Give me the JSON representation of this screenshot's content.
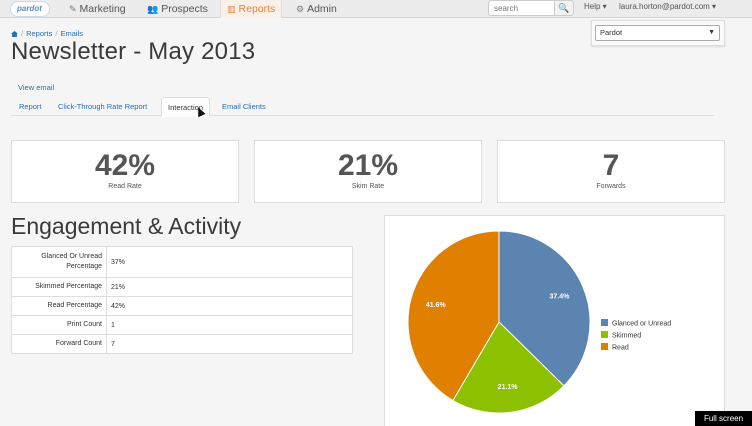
{
  "nav": {
    "logo": "pardot",
    "items": [
      {
        "label": "Marketing",
        "icon": "pencil-icon"
      },
      {
        "label": "Prospects",
        "icon": "users-icon"
      },
      {
        "label": "Reports",
        "icon": "bar-chart-icon"
      },
      {
        "label": "Admin",
        "icon": "gear-icon"
      }
    ],
    "search_placeholder": "search",
    "search_icon": "search-icon",
    "help": "Help ▾",
    "user": "laura.horton@pardot.com ▾"
  },
  "breadcrumb": [
    "Reports",
    "Emails"
  ],
  "page_title": "Newsletter - May 2013",
  "account_select": "Pardot",
  "view_email": "View email",
  "tabs": [
    "Report",
    "Click-Through Rate Report",
    "Interaction",
    "Email Clients"
  ],
  "kpis": [
    {
      "value": "42%",
      "label": "Read Rate"
    },
    {
      "value": "21%",
      "label": "Skim Rate"
    },
    {
      "value": "7",
      "label": "Forwards"
    }
  ],
  "section_title": "Engagement & Activity",
  "stats": [
    {
      "label": "Glanced Or Unread Percentage",
      "value": "37%"
    },
    {
      "label": "Skimmed Percentage",
      "value": "21%"
    },
    {
      "label": "Read Percentage",
      "value": "42%"
    },
    {
      "label": "Print Count",
      "value": "1"
    },
    {
      "label": "Forward Count",
      "value": "7"
    }
  ],
  "chart_data": {
    "type": "pie",
    "series": [
      {
        "name": "Glanced or Unread",
        "value": 37.4,
        "label": "37.4%",
        "color": "#5b84b1"
      },
      {
        "name": "Skimmed",
        "value": 21.1,
        "label": "21.1%",
        "color": "#8cc000"
      },
      {
        "name": "Read",
        "value": 41.6,
        "label": "41.6%",
        "color": "#e07f00"
      }
    ],
    "legend": "right"
  },
  "fullscreen": "Full screen"
}
